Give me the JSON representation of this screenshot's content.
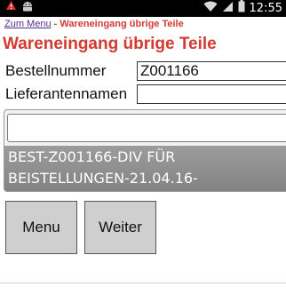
{
  "status_bar": {
    "time": "12:55",
    "icons": [
      "notification-icon",
      "android-icon",
      "wifi-icon",
      "signal-icon",
      "battery-icon"
    ]
  },
  "header": {
    "back_link": "Zum Menu",
    "separator": " - ",
    "subtitle": "Wareneingang übrige Teile"
  },
  "title": "Wareneingang übrige Teile",
  "form": {
    "order_number_label": "Bestellnummer",
    "order_number_value": "Z001166",
    "supplier_label": "Lieferantennamen",
    "supplier_value": ""
  },
  "list": {
    "search_value": "",
    "items": [
      {
        "line1": "BEST-Z001166-DIV FÜR",
        "line2": "BEISTELLUNGEN-21.04.16-"
      }
    ]
  },
  "buttons": {
    "menu": "Menu",
    "next": "Weiter"
  },
  "colors": {
    "accent": "#d33a32",
    "link": "#5a2d91",
    "list_item_bg": "#8f8f8f",
    "button_bg": "#cfcfcf"
  }
}
